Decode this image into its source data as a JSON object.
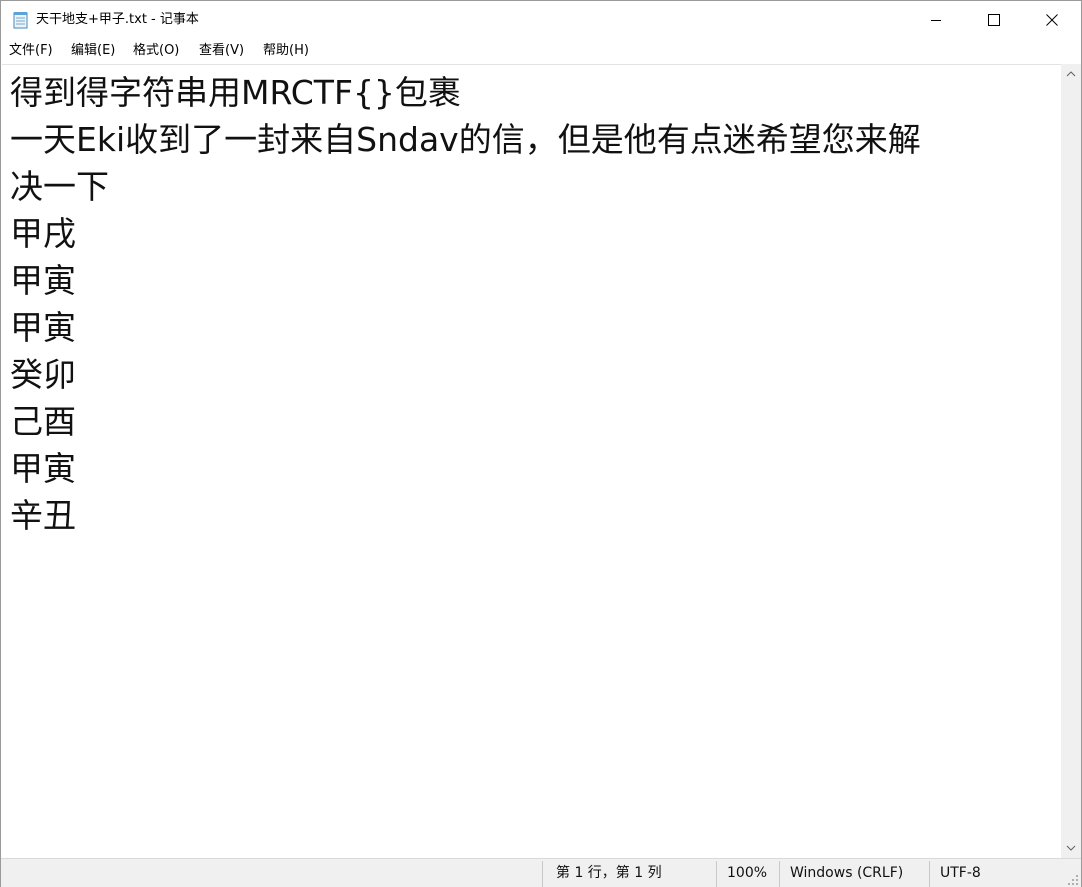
{
  "window": {
    "title": "天干地支+甲子.txt - 记事本",
    "icons": {
      "app": "notepad-icon",
      "minimize": "minimize-icon",
      "maximize": "maximize-icon",
      "close": "close-icon"
    }
  },
  "menu": {
    "file": "文件(F)",
    "edit": "编辑(E)",
    "format": "格式(O)",
    "view": "查看(V)",
    "help": "帮助(H)"
  },
  "editor": {
    "lines": [
      "得到得字符串用MRCTF{}包裹",
      "一天Eki收到了一封来自Sndav的信，但是他有点迷希望您来解",
      "决一下",
      "甲戌",
      "甲寅",
      "甲寅",
      "癸卯",
      "己酉",
      "甲寅",
      "辛丑"
    ]
  },
  "status": {
    "position": "第 1 行，第 1 列",
    "zoom": "100%",
    "line_endings": "Windows (CRLF)",
    "encoding": "UTF-8"
  },
  "colors": {
    "status_bg": "#f0f0f0",
    "text": "#111111",
    "border": "#9a9a9a"
  }
}
